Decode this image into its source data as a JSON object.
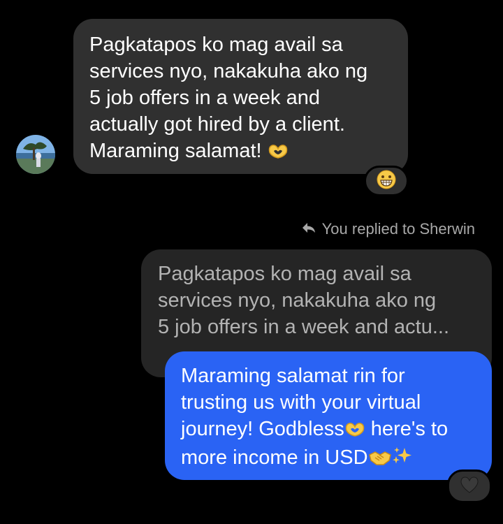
{
  "colors": {
    "background": "#000000",
    "incoming_bubble": "#303030",
    "quoted_bubble": "#252525",
    "outgoing_bubble": "#2a63f4",
    "muted_text": "#a8a8a8"
  },
  "incoming": {
    "lines": [
      "Pagkatapos ko mag avail sa",
      "services nyo, nakakuha ako ng",
      "5 job offers in a week and",
      "actually got hired by a client.",
      "Maraming salamat! "
    ],
    "emoji_icon": "heart-hands-icon",
    "reaction_icon": "grinning-face-icon"
  },
  "reply_indicator": {
    "text": "You replied to Sherwin",
    "icon": "reply-arrow-icon"
  },
  "quoted": {
    "lines": [
      "Pagkatapos ko mag avail sa",
      "services nyo, nakakuha ako ng",
      "5 job offers in a week and actu..."
    ]
  },
  "outgoing": {
    "line1": "Maraming salamat rin for",
    "line2": "trusting us with your virtual",
    "line3a": "journey! Godbless",
    "line3b": " here's to",
    "line4": "more income in USD",
    "emoji_icons": [
      "heart-hands-icon",
      "handshake-icon",
      "sparkles-icon"
    ],
    "reaction_icon": "black-heart-icon"
  }
}
